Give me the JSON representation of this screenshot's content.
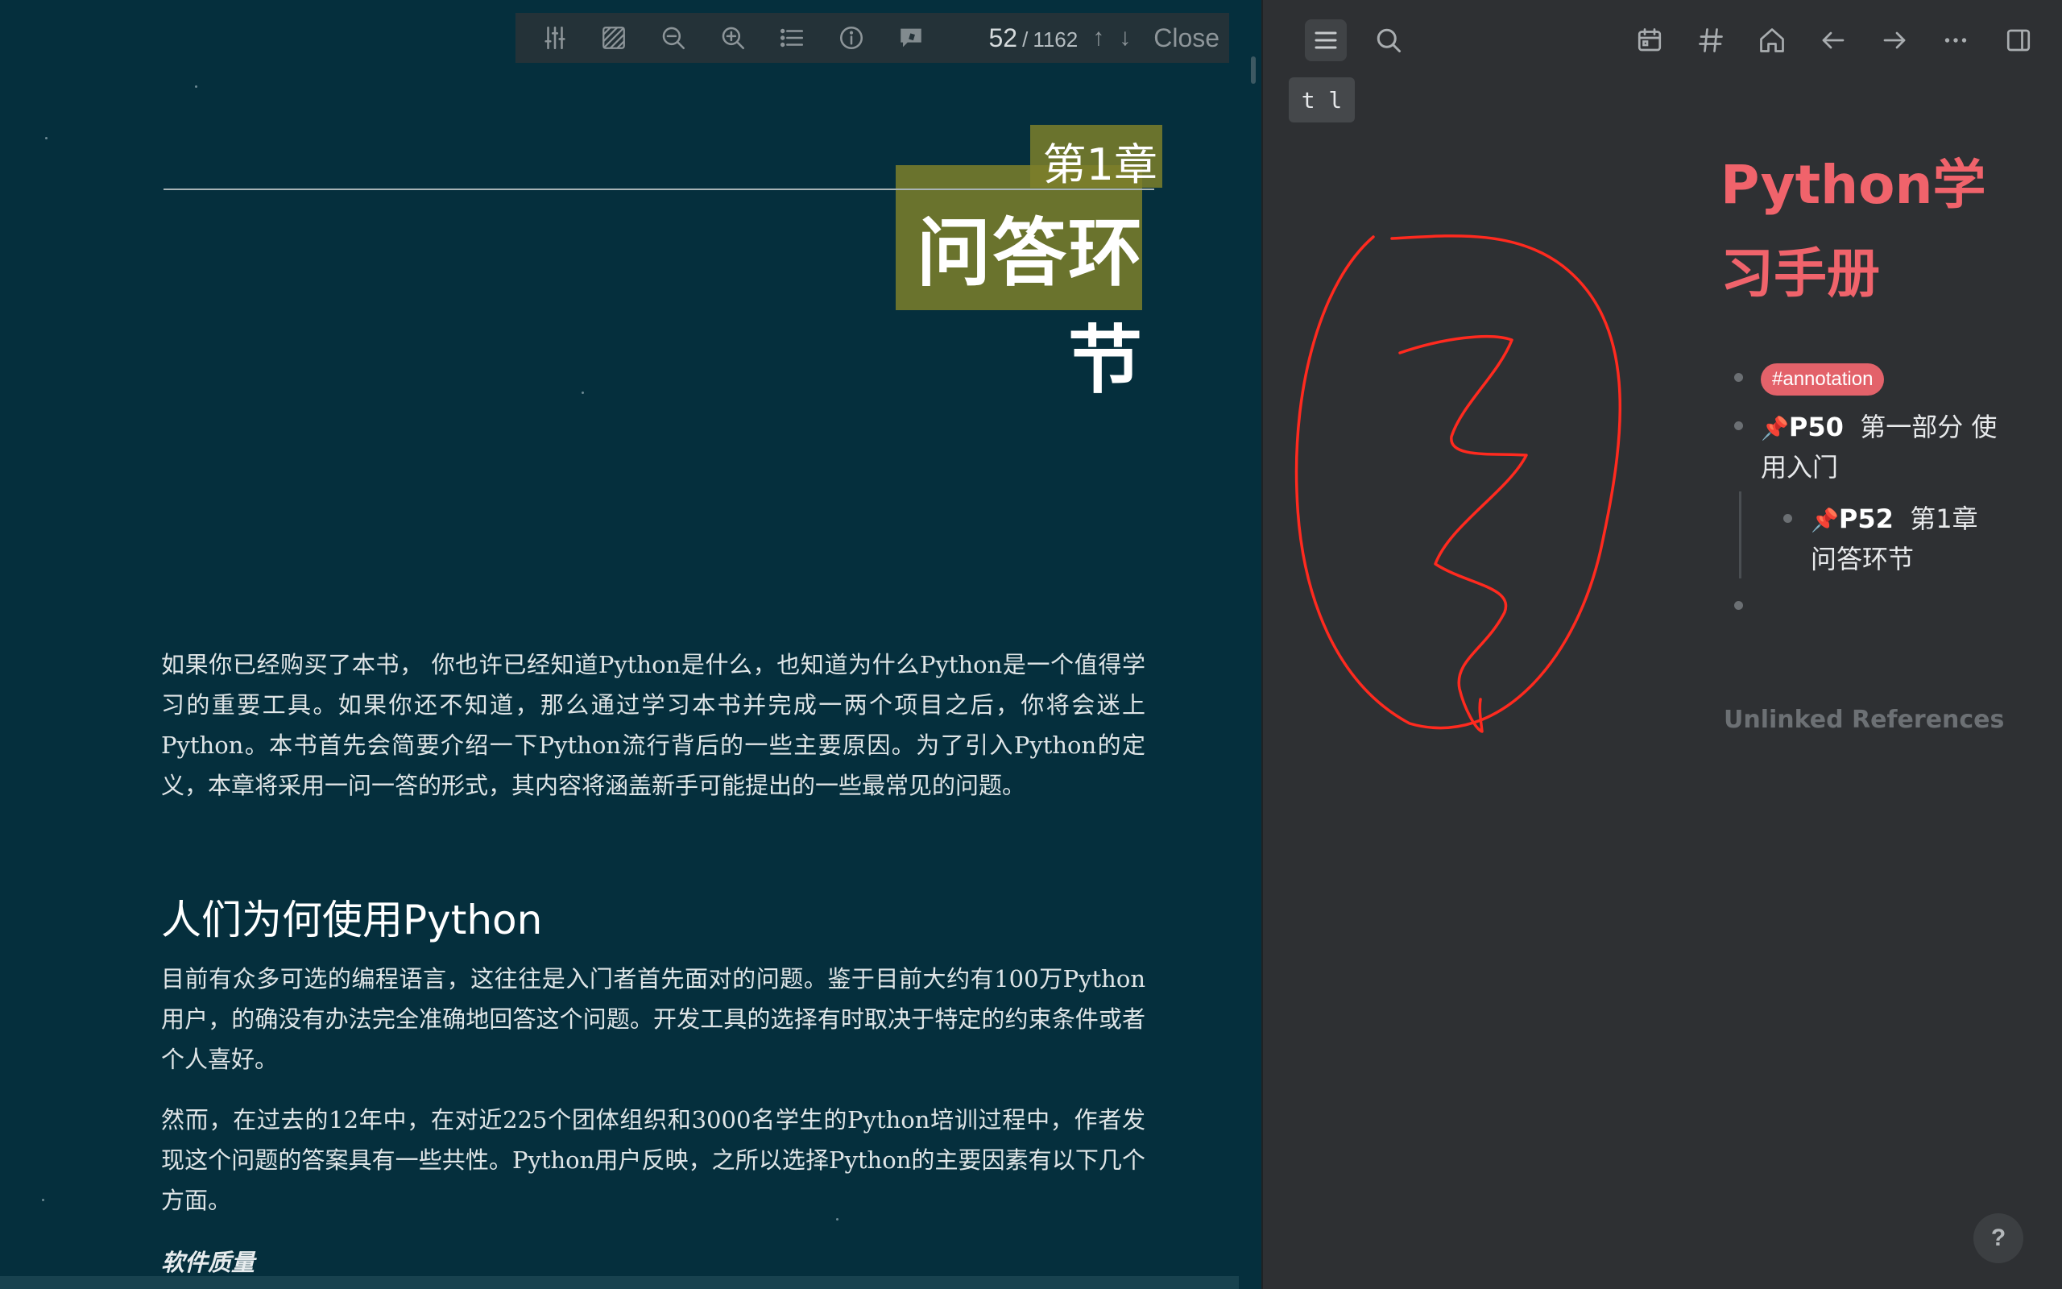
{
  "pdf_toolbar": {
    "icons": [
      "sliders-icon",
      "hatch-icon",
      "zoom-out-icon",
      "zoom-in-icon",
      "outline-list-icon",
      "info-icon",
      "highlight-icon"
    ],
    "page_current": "52",
    "page_separator": "/",
    "page_total": "1162",
    "up_arrow": "↑",
    "down_arrow": "↓",
    "close_label": "Close"
  },
  "pdf_page": {
    "chapter_label": "第1章",
    "chapter_title": "问答环节",
    "para1": "如果你已经购买了本书， 你也许已经知道Python是什么，也知道为什么Python是一个值得学习的重要工具。如果你还不知道，那么通过学习本书并完成一两个项目之后，你将会迷上Python。本书首先会简要介绍一下Python流行背后的一些主要原因。为了引入Python的定义，本章将采用一问一答的形式，其内容将涵盖新手可能提出的一些最常见的问题。",
    "section_heading": "人们为何使用Python",
    "para2": "目前有众多可选的编程语言，这往往是入门者首先面对的问题。鉴于目前大约有100万Python用户，的确没有办法完全准确地回答这个问题。开发工具的选择有时取决于特定的约束条件或者个人喜好。",
    "para3": "然而，在过去的12年中，在对近225个团体组织和3000名学生的Python培训过程中，作者发现这个问题的答案具有一些共性。Python用户反映，之所以选择Python的主要因素有以下几个方面。",
    "subsection_heading": "软件质量"
  },
  "sidebar": {
    "tooltip": "t l",
    "doc_title": "Python学习手册",
    "tag": "#annotation",
    "items": [
      {
        "pin": "📌",
        "page": "P50",
        "text": "第一部分 使用入门"
      },
      {
        "pin": "📌",
        "page": "P52",
        "text": "第1章 问答环节"
      }
    ],
    "unlinked_references": "Unlinked References",
    "help": "?"
  },
  "colors": {
    "pdf_background": "#052f3d",
    "highlight": "#7d7f2a",
    "accent": "#f0636b",
    "tag_background": "#e3626a",
    "pen_stroke": "#ff2a1f",
    "sidebar_background": "#2e3033"
  }
}
